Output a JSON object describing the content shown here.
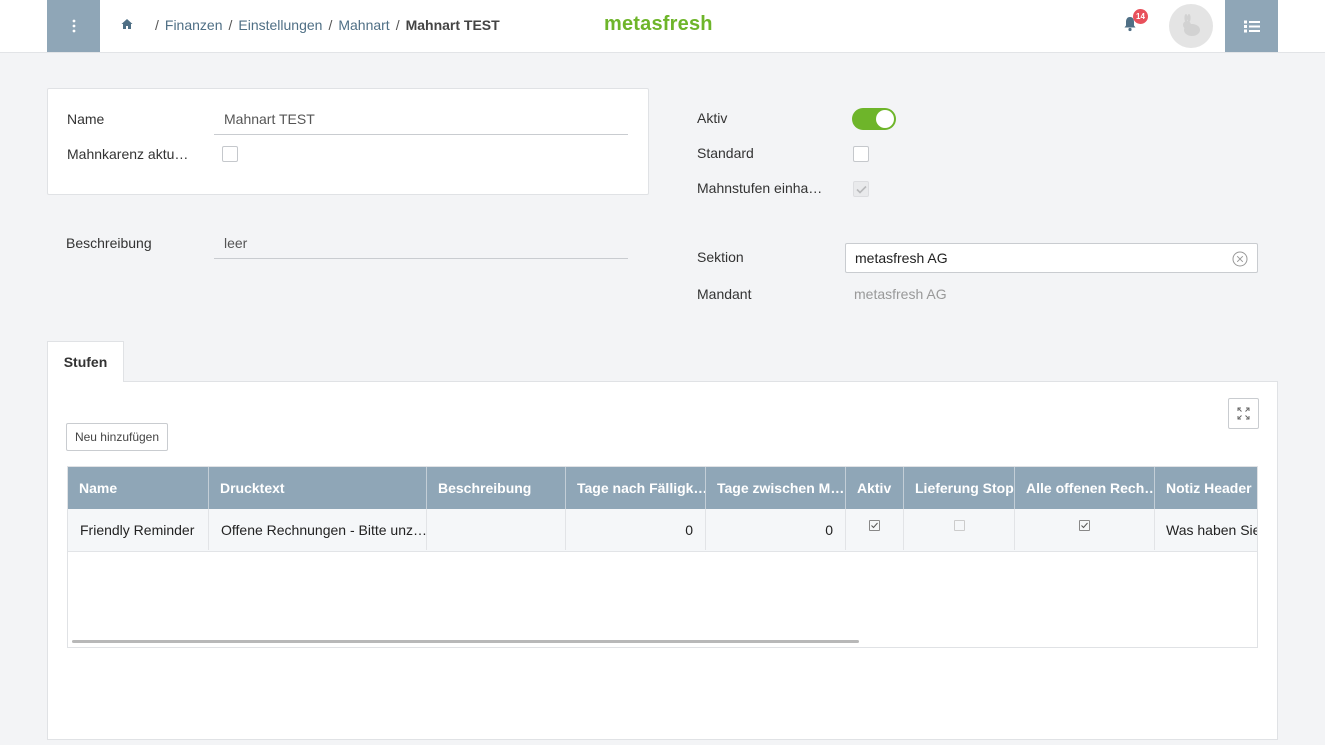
{
  "topbar": {
    "breadcrumb": [
      "Finanzen",
      "Einstellungen",
      "Mahnart",
      "Mahnart TEST"
    ],
    "logo": "metasfresh",
    "notification_count": "14"
  },
  "form": {
    "name_label": "Name",
    "name_value": "Mahnart TEST",
    "mahnkarenz_label": "Mahnkarenz aktu…",
    "mahnkarenz_checked": false,
    "beschreibung_label": "Beschreibung",
    "beschreibung_value": "leer",
    "aktiv_label": "Aktiv",
    "aktiv_on": true,
    "standard_label": "Standard",
    "standard_checked": false,
    "mahnstufen_label": "Mahnstufen einha…",
    "mahnstufen_checked": true,
    "sektion_label": "Sektion",
    "sektion_value": "metasfresh AG",
    "mandant_label": "Mandant",
    "mandant_value": "metasfresh AG"
  },
  "tabs": [
    {
      "label": "Stufen"
    }
  ],
  "panel": {
    "add_button": "Neu hinzufügen"
  },
  "table": {
    "columns": [
      "Name",
      "Drucktext",
      "Beschreibung",
      "Tage nach Fälligk…",
      "Tage zwischen M…",
      "Aktiv",
      "Lieferung Stop",
      "Alle offenen Rech…",
      "Notiz Header"
    ],
    "sorted_column": "Tage nach Fälligk…",
    "rows": [
      {
        "name": "Friendly Reminder",
        "drucktext": "Offene Rechnungen - Bitte unz…",
        "beschreibung": "",
        "tage_nach": "0",
        "tage_zwischen": "0",
        "aktiv": true,
        "lieferung_stop": false,
        "alle_offenen": true,
        "notiz_header": "Was haben Sie"
      }
    ]
  },
  "colors": {
    "accent_green": "#6eb52a",
    "header_blue_grey": "#8fa6b7",
    "badge_red": "#e8505b"
  }
}
